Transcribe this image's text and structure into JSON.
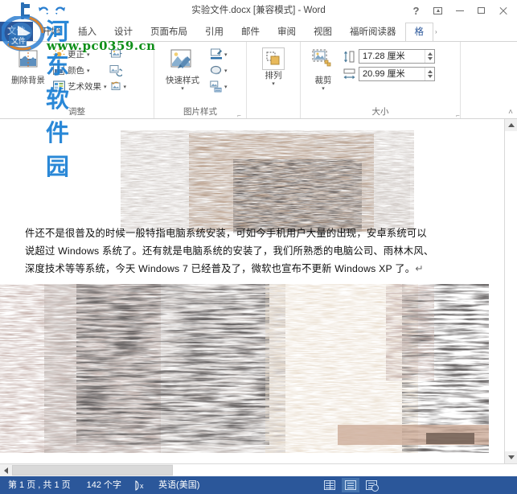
{
  "window": {
    "title": "实验文件.docx [兼容模式] - Word",
    "quick_access": [
      {
        "name": "word-app-icon",
        "label": "W"
      },
      {
        "name": "save-icon",
        "label": "保存"
      },
      {
        "name": "undo-icon",
        "label": "撤消"
      },
      {
        "name": "redo-icon",
        "label": "恢复"
      }
    ],
    "controls": [
      {
        "name": "help-button",
        "glyph": "?"
      },
      {
        "name": "ribbon-display-options-button",
        "glyph": "ribbon"
      },
      {
        "name": "minimize-button",
        "glyph": "minimize"
      },
      {
        "name": "maximize-button",
        "glyph": "maximize"
      },
      {
        "name": "close-button",
        "glyph": "close"
      }
    ]
  },
  "tabs": {
    "file_label": "文件",
    "items": [
      {
        "label": "开始",
        "active": false
      },
      {
        "label": "插入",
        "active": false
      },
      {
        "label": "设计",
        "active": false
      },
      {
        "label": "页面布局",
        "active": false
      },
      {
        "label": "引用",
        "active": false
      },
      {
        "label": "邮件",
        "active": false
      },
      {
        "label": "审阅",
        "active": false
      },
      {
        "label": "视图",
        "active": false
      },
      {
        "label": "福昕阅读器",
        "active": false
      },
      {
        "label": "格",
        "active": true
      }
    ],
    "scroll_arrow": "›"
  },
  "ribbon": {
    "groups": [
      {
        "name": "adjust",
        "label": "调整",
        "big_button": {
          "label": "删除背景"
        },
        "small_buttons": [
          {
            "label": "更正",
            "icon": "brightness-icon",
            "has_caret": true
          },
          {
            "label": "颜色",
            "icon": "color-picture-icon",
            "has_caret": true
          },
          {
            "label": "艺术效果",
            "icon": "artistic-effects-icon",
            "has_caret": true
          }
        ],
        "extra_icons": [
          {
            "name": "compress-pictures-icon",
            "caret": false
          },
          {
            "name": "change-picture-icon",
            "caret": false
          },
          {
            "name": "reset-picture-icon",
            "caret": true
          }
        ]
      },
      {
        "name": "picture-styles",
        "label": "图片样式",
        "big_button": {
          "label": "快速样式",
          "caret": "▾"
        },
        "extra_icons": [
          {
            "name": "picture-border-icon",
            "caret": true
          },
          {
            "name": "picture-effects-icon",
            "caret": true
          },
          {
            "name": "picture-layout-icon",
            "caret": true
          }
        ],
        "dialog_launcher": "⌐"
      },
      {
        "name": "arrange",
        "label": "",
        "big_button": {
          "label": "排列",
          "caret": "▾"
        }
      },
      {
        "name": "size",
        "label": "大小",
        "big_button": {
          "label": "裁剪",
          "caret": "▾"
        },
        "fields": [
          {
            "name": "shape-height",
            "value": "17.28",
            "unit": "厘米",
            "icon": "height-icon"
          },
          {
            "name": "shape-width",
            "value": "20.99",
            "unit": "厘米",
            "icon": "width-icon"
          }
        ],
        "dialog_launcher": "⌐"
      }
    ],
    "collapse_label": "˄"
  },
  "document": {
    "paragraph_lines": [
      "件还不是很普及的时候一般特指电脑系统安装，可如今手机用户大量的出现，安卓系统可以",
      "说超过 Windows 系统了。还有就是电脑系统的安装了，我们所熟悉的电脑公司、雨林木风、",
      "深度技术等等系统，今天 Windows 7 已经普及了，微软也宣布不更新 Windows XP 了。"
    ],
    "end_mark": "↵",
    "images": [
      {
        "name": "document-image-top",
        "alt": "背景已删除的图片上半部分"
      },
      {
        "name": "document-image-bottom",
        "alt": "背景已删除的图片下半部分"
      }
    ]
  },
  "status_bar": {
    "page_info": "第 1 页 , 共 1 页",
    "word_count": "142 个字",
    "proofing_icon": "proofing-errors-icon",
    "language": "英语(美国)",
    "views": [
      {
        "name": "read-mode-view-button",
        "label": "阅读视图",
        "selected": false
      },
      {
        "name": "print-layout-view-button",
        "label": "页面视图",
        "selected": true
      },
      {
        "name": "web-layout-view-button",
        "label": "Web 版式视图",
        "selected": false
      }
    ]
  },
  "watermark": {
    "site_name": "河东软件园",
    "url": "www.pc0359.cn"
  },
  "colors": {
    "accent": "#2b579a",
    "ribbon_bg": "#ffffff",
    "status_bg": "#2b579a",
    "watermark_blue": "#1a7fd4",
    "watermark_green": "#0e8f18"
  }
}
